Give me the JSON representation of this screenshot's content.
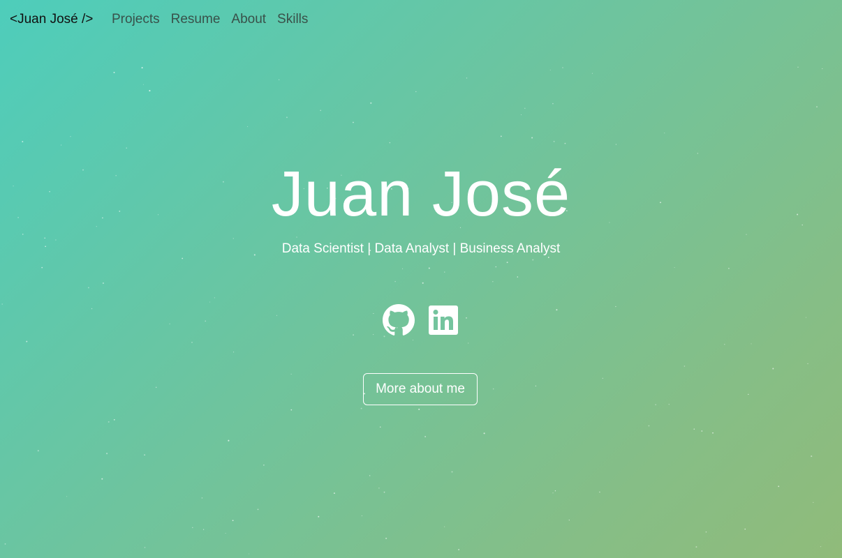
{
  "nav": {
    "brand": "<Juan José />",
    "links": [
      {
        "label": "Projects"
      },
      {
        "label": "Resume"
      },
      {
        "label": "About"
      },
      {
        "label": "Skills"
      }
    ]
  },
  "hero": {
    "name": "Juan José",
    "subtitle": "Data Scientist | Data Analyst | Business Analyst",
    "socials": [
      {
        "icon": "github-icon"
      },
      {
        "icon": "linkedin-icon"
      }
    ],
    "cta_label": "More about me"
  },
  "colors": {
    "gradient_start": "#4ecdbb",
    "gradient_end": "#90bb7a",
    "text": "#ffffff"
  }
}
